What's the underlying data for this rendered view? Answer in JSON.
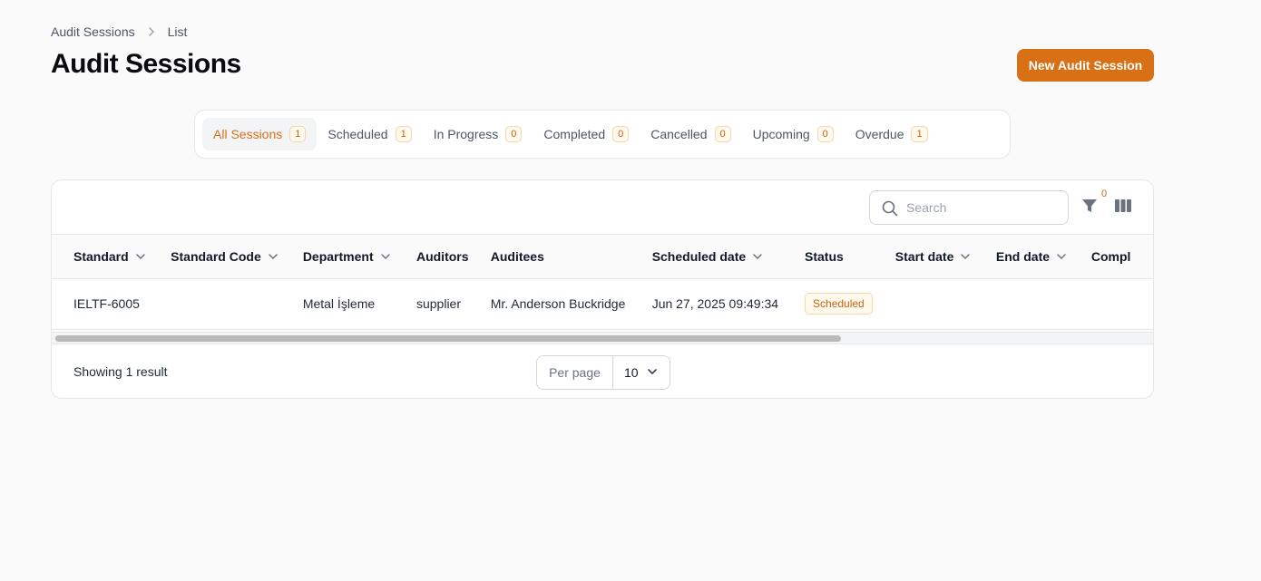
{
  "breadcrumb": {
    "parent": "Audit Sessions",
    "current": "List"
  },
  "page": {
    "title": "Audit Sessions",
    "new_button": "New Audit Session"
  },
  "tabs": [
    {
      "label": "All Sessions",
      "count": "1",
      "active": true
    },
    {
      "label": "Scheduled",
      "count": "1"
    },
    {
      "label": "In Progress",
      "count": "0"
    },
    {
      "label": "Completed",
      "count": "0"
    },
    {
      "label": "Cancelled",
      "count": "0"
    },
    {
      "label": "Upcoming",
      "count": "0"
    },
    {
      "label": "Overdue",
      "count": "1"
    }
  ],
  "toolbar": {
    "search_placeholder": "Search",
    "filter_count": "0"
  },
  "table": {
    "columns": [
      {
        "label": "Standard",
        "sortable": true
      },
      {
        "label": "Standard Code",
        "sortable": true
      },
      {
        "label": "Department",
        "sortable": true
      },
      {
        "label": "Auditors",
        "sortable": false
      },
      {
        "label": "Auditees",
        "sortable": false
      },
      {
        "label": "Scheduled date",
        "sortable": true
      },
      {
        "label": "Status",
        "sortable": false
      },
      {
        "label": "Start date",
        "sortable": true
      },
      {
        "label": "End date",
        "sortable": true
      },
      {
        "label": "Compl",
        "sortable": false
      }
    ],
    "rows": [
      {
        "standard": "IELTF-6005",
        "standard_code": "",
        "department": "Metal İşleme",
        "auditors": "supplier",
        "auditees": "Mr. Anderson Buckridge",
        "scheduled_date": "Jun 27, 2025 09:49:34",
        "status": "Scheduled",
        "start_date": "",
        "end_date": "",
        "compl": ""
      }
    ]
  },
  "footer": {
    "result_text": "Showing 1 result",
    "per_page_label": "Per page",
    "per_page_value": "10"
  },
  "colors": {
    "accent": "#d97015",
    "badge_bg": "#fff8ec",
    "badge_border": "#f5d8a8"
  }
}
